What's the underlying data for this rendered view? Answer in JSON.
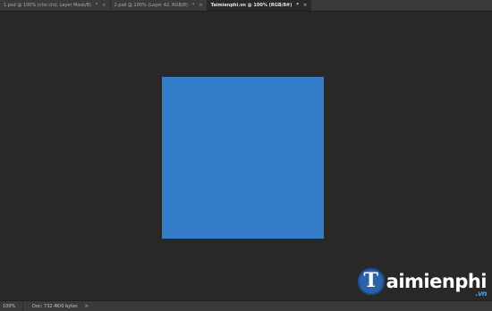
{
  "tabs": [
    {
      "label": "1.psd @ 100% (cho chữ, Layer Mask/8)",
      "modified": "*",
      "close": "×",
      "active": false
    },
    {
      "label": "2.psd @ 100% (Layer 42, RGB/8)",
      "modified": "*",
      "close": "×",
      "active": false
    },
    {
      "label": "Taimienphi.vn @ 100% (RGB/8#)",
      "modified": "*",
      "close": "×",
      "active": true
    }
  ],
  "canvas": {
    "fill_color": "#357dc9"
  },
  "status": {
    "zoom": "100%",
    "doc_info": "Doc: 732.4K/0 bytes",
    "arrow": ">"
  },
  "watermark": {
    "logo_letter": "T",
    "text": "aimienphi",
    "sub": ".vn"
  },
  "colors": {
    "workspace": "#282828",
    "chrome": "#3a3a3a",
    "canvas_fill": "#357dc9",
    "brand": "#2a63a8"
  }
}
